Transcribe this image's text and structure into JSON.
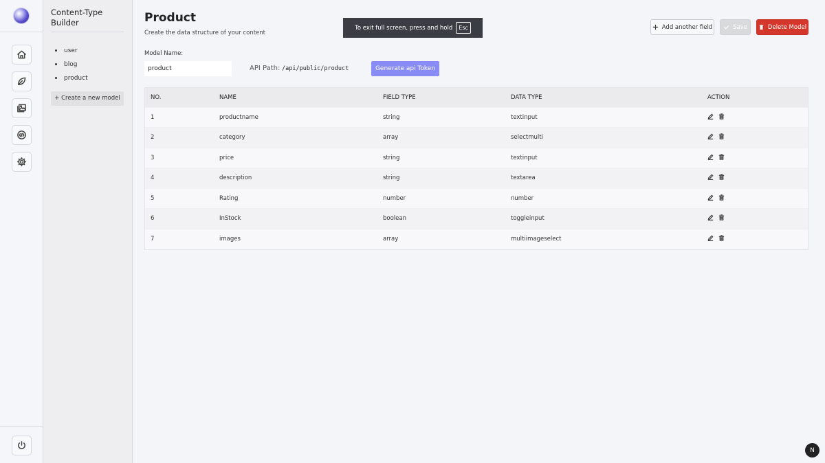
{
  "header": {
    "title": "Product",
    "subtitle": "Create the data structure of your content"
  },
  "fullscreen_toast": {
    "text": "To exit full screen, press and hold",
    "key": "Esc"
  },
  "toolbar": {
    "add_field_label": "Add another field",
    "save_label": "Save",
    "delete_label": "Delete Model"
  },
  "sidebar": {
    "title": "Content-Type Builder",
    "models": [
      "user",
      "blog",
      "product"
    ],
    "create_label": "+ Create a new model"
  },
  "rail": {
    "items": [
      "home-icon",
      "leaf-icon",
      "gallery-icon",
      "code-icon",
      "settings-icon"
    ],
    "bottom": "power-icon"
  },
  "model": {
    "name_label": "Model Name:",
    "name_value": "product",
    "api_label": "API Path:",
    "api_value": "/api/public/product",
    "token_button": "Generate api Token"
  },
  "table": {
    "headers": [
      "NO.",
      "NAME",
      "FIELD TYPE",
      "DATA TYPE",
      "ACTION"
    ],
    "rows": [
      {
        "no": "1",
        "name": "productname",
        "field_type": "string",
        "data_type": "textinput"
      },
      {
        "no": "2",
        "name": "category",
        "field_type": "array",
        "data_type": "selectmulti"
      },
      {
        "no": "3",
        "name": "price",
        "field_type": "string",
        "data_type": "textinput"
      },
      {
        "no": "4",
        "name": "description",
        "field_type": "string",
        "data_type": "textarea"
      },
      {
        "no": "5",
        "name": "Rating",
        "field_type": "number",
        "data_type": "number"
      },
      {
        "no": "6",
        "name": "InStock",
        "field_type": "boolean",
        "data_type": "toggleinput"
      },
      {
        "no": "7",
        "name": "images",
        "field_type": "array",
        "data_type": "multiimageselect"
      }
    ]
  },
  "badge": {
    "letter": "N"
  },
  "colors": {
    "accent": "#8a8cf5",
    "danger": "#d4382d",
    "background": "#f4f5f9"
  }
}
